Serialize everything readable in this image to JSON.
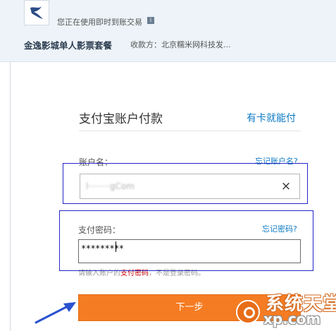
{
  "header": {
    "logo_icon": "swallow-logo-icon",
    "notice": "您正在使用即时到账交易",
    "info_icon_text": "i",
    "order_title": "金逸影城单人影票套餐",
    "payee": "收款方：北京糯米网科技发..."
  },
  "form": {
    "title": "支付宝账户付款",
    "card_link": "有卡就能付",
    "account_label": "账户名：",
    "forgot_account": "忘记账户名?",
    "account_value": "l········gCom",
    "clear_icon": "×",
    "password_label": "支付密码：",
    "forgot_password": "忘记密码?",
    "password_value": "*********",
    "hint_prefix": "请输入账户的",
    "hint_highlight": "支付密码",
    "hint_suffix": "，不是登录密码。",
    "next_button": "下一步"
  },
  "annotations": {
    "box_color": "#2326c6",
    "arrow_color": "#2a52d0"
  },
  "watermark": {
    "line1": "系统天堂",
    "line2": "xp.com"
  },
  "colors": {
    "accent_orange": "#f57c22",
    "link_blue": "#0c7ac4",
    "hint_red": "#c20000",
    "header_bg": "#edf3f8"
  }
}
